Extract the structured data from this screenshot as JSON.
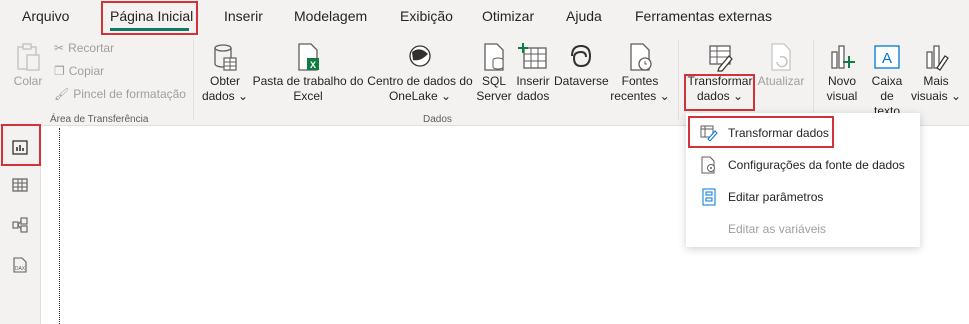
{
  "tabs": [
    "Arquivo",
    "Página Inicial",
    "Inserir",
    "Modelagem",
    "Exibição",
    "Otimizar",
    "Ajuda",
    "Ferramentas externas"
  ],
  "clipboard": {
    "paste": "Colar",
    "cut": "Recortar",
    "copy": "Copiar",
    "format_painter": "Pincel de formatação",
    "group": "Área de Transferência"
  },
  "data_group": {
    "get_data_1": "Obter",
    "get_data_2": "dados",
    "excel_1": "Pasta de trabalho do",
    "excel_2": "Excel",
    "onelake_1": "Centro de dados do",
    "onelake_2": "OneLake",
    "sql_1": "SQL",
    "sql_2": "Server",
    "insert_1": "Inserir",
    "insert_2": "dados",
    "dataverse": "Dataverse",
    "recent_1": "Fontes",
    "recent_2": "recentes",
    "group": "Dados"
  },
  "queries": {
    "transform_1": "Transformar",
    "transform_2": "dados",
    "refresh": "Atualizar"
  },
  "insert_group": {
    "new_visual_1": "Novo",
    "new_visual_2": "visual",
    "textbox_1": "Caixa de",
    "textbox_2": "texto",
    "more_1": "Mais",
    "more_2": "visuais"
  },
  "dropdown": {
    "item1": "Transformar dados",
    "item2": "Configurações da fonte de dados",
    "item3": "Editar parâmetros",
    "item4": "Editar as variáveis"
  },
  "colors": {
    "accent": "#117865",
    "highlight": "#d13438"
  }
}
